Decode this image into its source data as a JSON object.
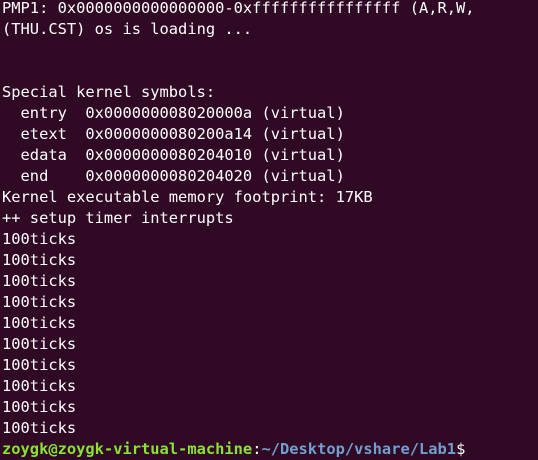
{
  "terminal": {
    "lines": [
      "PMP1: 0x0000000000000000-0xffffffffffffffff (A,R,W,",
      "(THU.CST) os is loading ...",
      "",
      "",
      "Special kernel symbols:",
      "  entry  0x000000008020000a (virtual)",
      "  etext  0x0000000080200a14 (virtual)",
      "  edata  0x0000000080204010 (virtual)",
      "  end    0x0000000080204020 (virtual)",
      "Kernel executable memory footprint: 17KB",
      "++ setup timer interrupts",
      "100ticks",
      "100ticks",
      "100ticks",
      "100ticks",
      "100ticks",
      "100ticks",
      "100ticks",
      "100ticks",
      "100ticks",
      "100ticks"
    ],
    "prompt": {
      "user_host": "zoygk@zoygk-virtual-machine",
      "separator": ":",
      "path": "~/Desktop/vshare/Lab1",
      "symbol": "$"
    }
  },
  "colors": {
    "background": "#300a24",
    "text": "#ffffff",
    "prompt_user": "#8ae234",
    "prompt_path": "#729fcf"
  }
}
